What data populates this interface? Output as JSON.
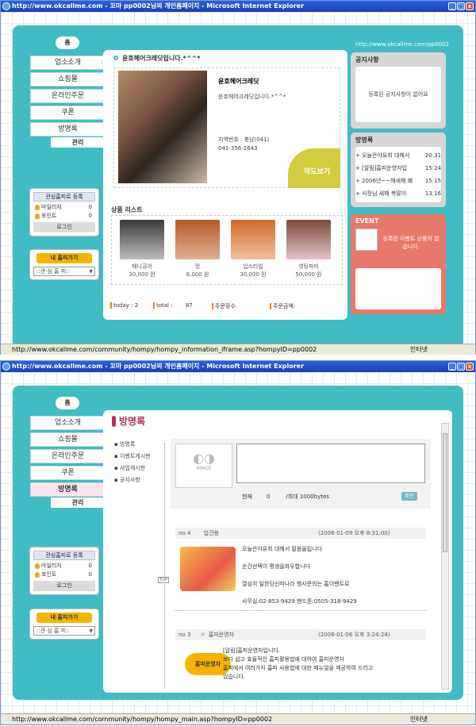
{
  "window1": {
    "title": "http://www.okcallme.com - 꼬마 pp0002님의 개인홈페이지 - Microsoft Internet Explorer",
    "url_label": "http://www.okcallme.com/pp0002",
    "status_url": "http://www.okcallme.com/community/hompy/hompy_information_iframe.asp?hompyID=pp0002",
    "status_zone": "인터넷",
    "home_label": "홈",
    "menu": [
      "업소소개",
      "쇼핑몰",
      "온라인주문",
      "쿠폰",
      "방명록"
    ],
    "admin_label": "관리",
    "side": {
      "header": "관심홈피로 등록",
      "mileage_label": "마일리지",
      "mileage_value": "0",
      "point_label": "포인트",
      "point_value": "0",
      "login": "로그인"
    },
    "myhome": {
      "button": "내 홈피가기",
      "select": "::관 심 홈 피::"
    },
    "heading": "윤호헤어크레딧입니다.*^^*",
    "business": {
      "name": "윤호헤어크레딧",
      "desc": "윤호헤어크레딧입니다.*^^*",
      "region": "지역번호 : 충남(041)",
      "phone": "041-356-2643",
      "map_button": "약도보기"
    },
    "notice": {
      "title": "공지사항",
      "empty": "등록된 공지사항이 없어요"
    },
    "guestbook": {
      "title": "방명록",
      "items": [
        {
          "text": "+ 오늘은야유회 대해서",
          "time": "20:31"
        },
        {
          "text": "+ [알림]홈피운영자입",
          "time": "15:24"
        },
        {
          "text": "+ 2006년~~해새해 폐",
          "time": "15:15"
        },
        {
          "text": "+ 사장님 새해 복많이",
          "time": "13:16"
        }
      ]
    },
    "event": {
      "title": "EVENT",
      "empty": "등록된 이벤트 상품이 없습니다."
    },
    "products_title": "상품 리스트",
    "products": [
      {
        "name": "매니큐어",
        "price": "30,000 원"
      },
      {
        "name": "컷",
        "price": "8,000 원"
      },
      {
        "name": "업스타일",
        "price": "30,000 원"
      },
      {
        "name": "셋팅파마",
        "price": "50,000 원"
      }
    ],
    "stats": {
      "today_label": "today :",
      "today": "2",
      "total_label": "total :",
      "total": "87",
      "orders_label": "주문횟수:",
      "amount_label": "주문금액:"
    }
  },
  "window2": {
    "title": "http://www.okcallme.com - 꼬마 pp0002님의 개인홈페이지 - Microsoft Internet Explorer",
    "status_url": "http://www.okcallme.com/community/hompy/hompy_main.asp?hompyID=pp0002",
    "status_zone": "인터넷",
    "home_label": "홈",
    "menu": [
      "업소소개",
      "쇼핑몰",
      "온라인주문",
      "쿠폰",
      "방명록"
    ],
    "admin_label": "관리",
    "side": {
      "header": "관심홈피로 등록",
      "mileage_label": "마일리지",
      "mileage_value": "0",
      "point_label": "포인트",
      "point_value": "0",
      "login": "로그인"
    },
    "myhome": {
      "button": "내 홈피가기",
      "select": "::관 심 홈 피::"
    },
    "page_title": "방명록",
    "subnav": [
      "방명록",
      "이벤트게시판",
      "사업게시판",
      "공지사항"
    ],
    "image_label": "IMAGE",
    "counter": {
      "label": "현재",
      "value": "0",
      "max": "/최대 1000bytes",
      "confirm": "확인"
    },
    "top_label": "TOP",
    "entries": [
      {
        "no": "no 4",
        "author": "업건용",
        "date": "(2006-01-09 오후 8:31:00)",
        "lines": [
          "오늘은야유회 대해서 말씀올립니다",
          "순간선택이 평생을좌우합니다",
          "열심히 일한당신떠나라 행사문의는 홈이벤트로",
          "사무실:02-853-9429 핸드폰:0505-318-9429"
        ]
      },
      {
        "no": "no 3",
        "author": "홈피운영자",
        "date": "(2006-01-06 오후 3:24:24)",
        "badge": "홈피운영자",
        "lines": [
          "[알림]홈피운영자입니다.",
          "보다 쉽고 효율적인 홈피활용법에 대하여 홈피운영자",
          "홈피에서 여러가지 홈피 사용법에 대한 메뉴얼을 제공하여 드리고",
          "있습니다."
        ]
      }
    ]
  }
}
